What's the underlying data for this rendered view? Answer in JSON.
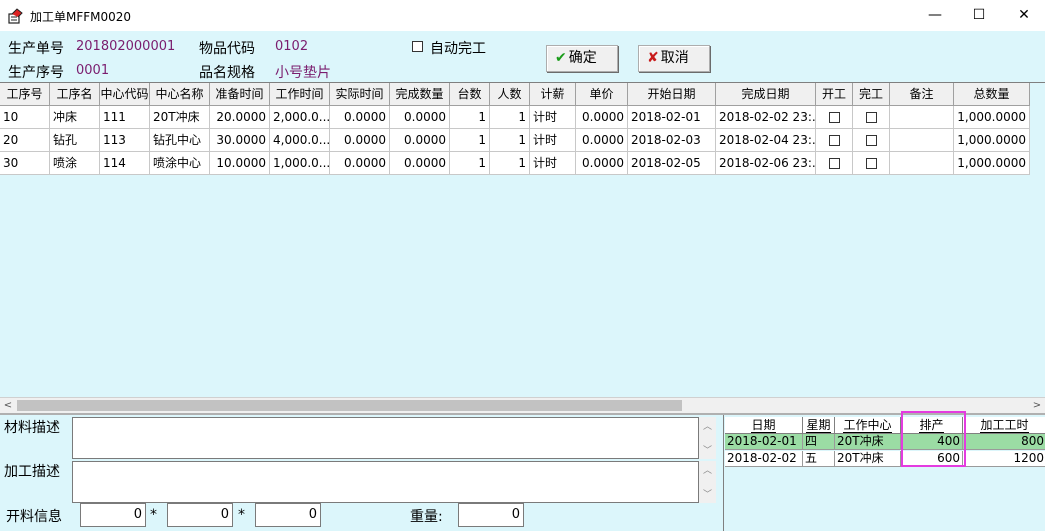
{
  "window": {
    "title": "加工单MFFM0020",
    "minimize": "—",
    "maximize": "☐",
    "close": "✕"
  },
  "header": {
    "order_no_label": "生产单号",
    "order_no_value": "201802000001",
    "seq_no_label": "生产序号",
    "seq_no_value": "0001",
    "item_code_label": "物品代码",
    "item_code_value": "0102",
    "spec_label": "品名规格",
    "spec_value": "小号垫片",
    "auto_complete_label": "自动完工",
    "confirm_label": "确定",
    "cancel_label": "取消"
  },
  "grid": {
    "columns": [
      "工序号",
      "工序名",
      "中心代码",
      "中心名称",
      "准备时间",
      "工作时间",
      "实际时间",
      "完成数量",
      "台数",
      "人数",
      "计薪",
      "单价",
      "开始日期",
      "完成日期",
      "开工",
      "完工",
      "备注",
      "总数量"
    ],
    "rows": [
      [
        "10",
        "冲床",
        "111",
        "20T冲床",
        "20.0000",
        "2,000.0...",
        "0.0000",
        "0.0000",
        "1",
        "1",
        "计时",
        "0.0000",
        "2018-02-01",
        "2018-02-02 23:...",
        "",
        "",
        "",
        "1,000.0000"
      ],
      [
        "20",
        "钻孔",
        "113",
        "钻孔中心",
        "30.0000",
        "4,000.0...",
        "0.0000",
        "0.0000",
        "1",
        "1",
        "计时",
        "0.0000",
        "2018-02-03",
        "2018-02-04 23:...",
        "",
        "",
        "",
        "1,000.0000"
      ],
      [
        "30",
        "喷涂",
        "114",
        "喷涂中心",
        "10.0000",
        "1,000.0...",
        "0.0000",
        "0.0000",
        "1",
        "1",
        "计时",
        "0.0000",
        "2018-02-05",
        "2018-02-06 23:...",
        "",
        "",
        "",
        "1,000.0000"
      ]
    ]
  },
  "bottom": {
    "material_label": "材料描述",
    "process_label": "加工描述",
    "cutting_label": "开料信息",
    "cut_1": "0",
    "cut_2": "0",
    "cut_3": "0",
    "times": "*",
    "weight_label": "重量:",
    "weight_value": "0"
  },
  "schedule": {
    "columns": [
      "日期",
      "星期",
      "工作中心",
      "排产",
      "加工工时"
    ],
    "rows": [
      [
        "2018-02-01",
        "四",
        "20T冲床",
        "400",
        "800"
      ],
      [
        "2018-02-02",
        "五",
        "20T冲床",
        "600",
        "1200"
      ]
    ]
  },
  "colors": {
    "background": "#dcf6fb",
    "accent_value": "#7a1d6e",
    "selected_row": "#9bdca4",
    "highlight": "#e43be0"
  }
}
